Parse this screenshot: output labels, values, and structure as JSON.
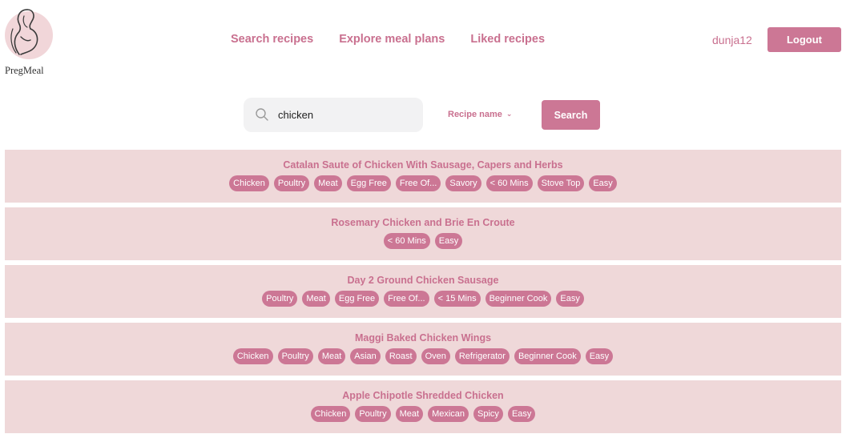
{
  "brand": {
    "name": "PregMeal",
    "logo_icon": "pregnant-woman-logo-icon",
    "accent_color": "#cc7795",
    "card_color": "#efd8d9"
  },
  "nav": {
    "items": [
      {
        "label": "Search recipes"
      },
      {
        "label": "Explore meal plans"
      },
      {
        "label": "Liked recipes"
      }
    ]
  },
  "user": {
    "username": "dunja12",
    "logout_label": "Logout"
  },
  "search": {
    "query": "chicken",
    "icon": "search-icon",
    "filter_label": "Recipe name",
    "filter_icon": "chevron-down-icon",
    "button_label": "Search"
  },
  "results": [
    {
      "title": "Catalan Saute of Chicken With Sausage, Capers and Herbs",
      "tags": [
        "Chicken",
        "Poultry",
        "Meat",
        "Egg Free",
        "Free Of...",
        "Savory",
        "< 60 Mins",
        "Stove Top",
        "Easy"
      ]
    },
    {
      "title": "Rosemary Chicken and Brie En Croute",
      "tags": [
        "< 60 Mins",
        "Easy"
      ]
    },
    {
      "title": "Day 2 Ground Chicken Sausage",
      "tags": [
        "Poultry",
        "Meat",
        "Egg Free",
        "Free Of...",
        "< 15 Mins",
        "Beginner Cook",
        "Easy"
      ]
    },
    {
      "title": "Maggi Baked Chicken Wings",
      "tags": [
        "Chicken",
        "Poultry",
        "Meat",
        "Asian",
        "Roast",
        "Oven",
        "Refrigerator",
        "Beginner Cook",
        "Easy"
      ]
    },
    {
      "title": "Apple Chipotle Shredded Chicken",
      "tags": [
        "Chicken",
        "Poultry",
        "Meat",
        "Mexican",
        "Spicy",
        "Easy"
      ]
    }
  ]
}
